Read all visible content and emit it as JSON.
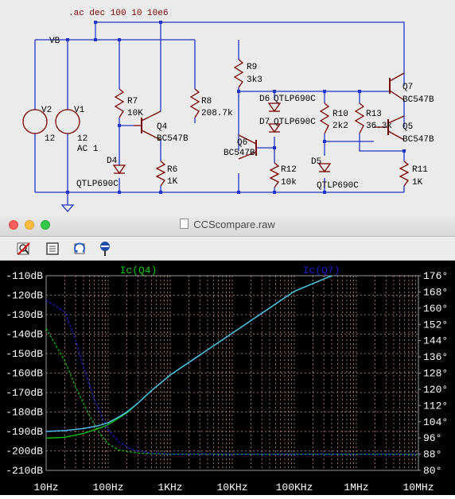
{
  "schematic": {
    "directive": ".ac dec 100 10 10e6",
    "net_vb": "VB",
    "sources": [
      {
        "ref": "V2",
        "value": "12"
      },
      {
        "ref": "V1",
        "value": "12",
        "ac": "AC 1"
      }
    ],
    "resistors": [
      {
        "ref": "R7",
        "value": "10K"
      },
      {
        "ref": "R8",
        "value": "208.7k"
      },
      {
        "ref": "R6",
        "value": "1K"
      },
      {
        "ref": "R9",
        "value": "3k3"
      },
      {
        "ref": "R12",
        "value": "10k"
      },
      {
        "ref": "R10",
        "value": "2k2"
      },
      {
        "ref": "R13",
        "value": "36.3k"
      },
      {
        "ref": "R11",
        "value": "1K"
      }
    ],
    "transistors": [
      {
        "ref": "Q4",
        "model": "BC547B"
      },
      {
        "ref": "Q6",
        "model": "BC547B"
      },
      {
        "ref": "Q7",
        "model": "BC547B"
      },
      {
        "ref": "Q5",
        "model": "BC547B"
      }
    ],
    "leds": [
      {
        "ref": "D4",
        "model": "QTLP690C"
      },
      {
        "ref": "D6",
        "model": "QTLP690C"
      },
      {
        "ref": "D7",
        "model": "QTLP690C"
      },
      {
        "ref": "D5",
        "model": "QTLP690C"
      }
    ]
  },
  "window": {
    "title": "CCScompare.raw"
  },
  "toolbar": {
    "icons": [
      "zoom-cancel-icon",
      "autorange-icon",
      "undo-zoom-icon",
      "probe-icon"
    ]
  },
  "colors": {
    "q4_trace": "#00c800",
    "q7_trace": "#1c1ccc",
    "phase_trace": "#4ec3ff",
    "grid": "#c88a7a",
    "axis_text": "#ffffff",
    "wire": "#2233c8",
    "component": "#7a0000"
  },
  "chart_data": {
    "type": "line",
    "x_scale": "log",
    "x_ticks": [
      "10Hz",
      "100Hz",
      "1KHz",
      "10KHz",
      "100KHz",
      "1MHz",
      "10MHz"
    ],
    "xlim": [
      10,
      10000000
    ],
    "y_left_ticks": [
      "-110dB",
      "-120dB",
      "-130dB",
      "-140dB",
      "-150dB",
      "-160dB",
      "-170dB",
      "-180dB",
      "-190dB",
      "-200dB",
      "-210dB"
    ],
    "ylim_left": [
      -210,
      -110
    ],
    "y_right_ticks": [
      "176°",
      "168°",
      "160°",
      "152°",
      "144°",
      "136°",
      "128°",
      "120°",
      "112°",
      "104°",
      "96°",
      "88°",
      "80°"
    ],
    "ylim_right": [
      80,
      176
    ],
    "grid": true,
    "series": [
      {
        "name": "Ic(Q4)",
        "magnitude": [
          [
            10,
            -193.5
          ],
          [
            20,
            -193
          ],
          [
            40,
            -191
          ],
          [
            70,
            -188.5
          ],
          [
            100,
            -186.5
          ],
          [
            150,
            -183
          ],
          [
            200,
            -180.5
          ],
          [
            300,
            -175.5
          ],
          [
            500,
            -169
          ],
          [
            1000,
            -161
          ],
          [
            10000,
            -139.5
          ],
          [
            100000,
            -118
          ],
          [
            400000,
            -110
          ]
        ],
        "phase": [
          [
            10,
            150
          ],
          [
            20,
            134
          ],
          [
            30,
            121
          ],
          [
            50,
            107
          ],
          [
            70,
            99
          ],
          [
            100,
            93
          ],
          [
            150,
            90
          ],
          [
            300,
            88.5
          ],
          [
            1000,
            88
          ],
          [
            10000000,
            88
          ]
        ]
      },
      {
        "name": "Ic(Q7)",
        "magnitude": [
          [
            10,
            -190
          ],
          [
            20,
            -189.5
          ],
          [
            40,
            -188.5
          ],
          [
            70,
            -187
          ],
          [
            100,
            -185.5
          ],
          [
            150,
            -182.5
          ],
          [
            200,
            -180
          ],
          [
            300,
            -175.5
          ],
          [
            500,
            -169
          ],
          [
            1000,
            -161
          ],
          [
            10000,
            -139.5
          ],
          [
            100000,
            -118
          ],
          [
            400000,
            -110
          ]
        ],
        "phase": [
          [
            10,
            164
          ],
          [
            20,
            158
          ],
          [
            30,
            144
          ],
          [
            40,
            131
          ],
          [
            60,
            115
          ],
          [
            80,
            106
          ],
          [
            100,
            100
          ],
          [
            150,
            94
          ],
          [
            250,
            90
          ],
          [
            500,
            88.5
          ],
          [
            1000,
            88
          ],
          [
            10000000,
            88
          ]
        ]
      }
    ]
  }
}
